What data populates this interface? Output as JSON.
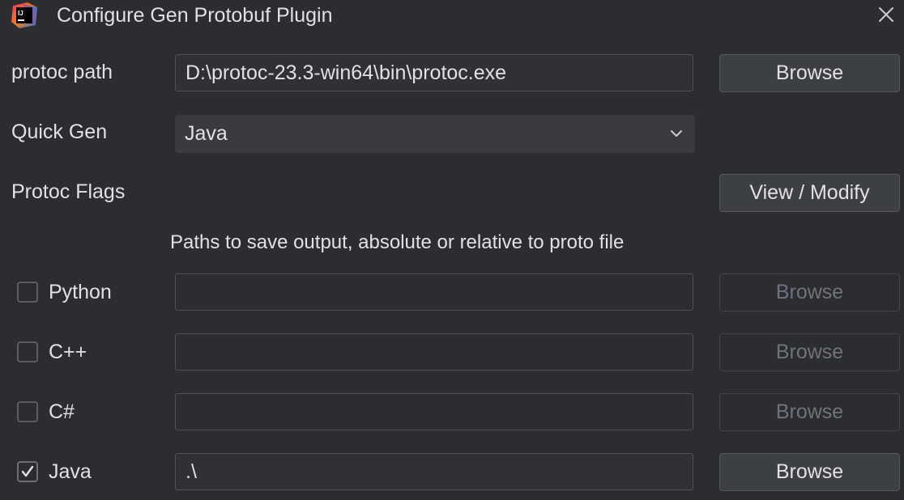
{
  "window": {
    "title": "Configure Gen Protobuf Plugin",
    "app_icon": "intellij-idea-icon",
    "close_icon": "close-icon"
  },
  "protoc_path": {
    "label": "protoc path",
    "value": "D:\\protoc-23.3-win64\\bin\\protoc.exe",
    "browse_label": "Browse"
  },
  "quick_gen": {
    "label": "Quick Gen",
    "selected": "Java",
    "chevron_icon": "chevron-down-icon"
  },
  "protoc_flags": {
    "label": "Protoc Flags",
    "button_label": "View / Modify"
  },
  "output_hint": "Paths to save output, absolute or relative to proto file",
  "languages": [
    {
      "label": "Python",
      "checked": false,
      "path": "",
      "browse_label": "Browse",
      "browse_enabled": false
    },
    {
      "label": "C++",
      "checked": false,
      "path": "",
      "browse_label": "Browse",
      "browse_enabled": false
    },
    {
      "label": "C#",
      "checked": false,
      "path": "",
      "browse_label": "Browse",
      "browse_enabled": false
    },
    {
      "label": "Java",
      "checked": true,
      "path": ".\\",
      "browse_label": "Browse",
      "browse_enabled": true
    }
  ],
  "colors": {
    "background": "#2b2d30",
    "text": "#dfe1e5",
    "disabled_text": "#6f737a",
    "button_bg": "#3c3f44",
    "combo_bg": "#393b40"
  }
}
